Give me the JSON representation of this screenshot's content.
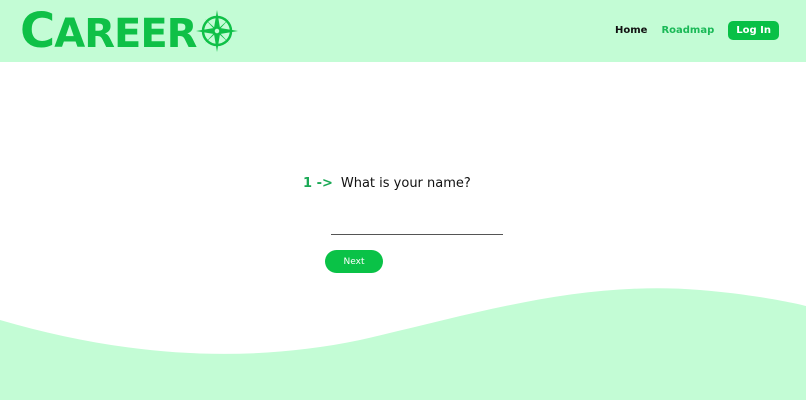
{
  "brand": {
    "logo_text": "AREER",
    "logo_initial": "C",
    "logo_icon": "compass-icon",
    "color": "#0fc047"
  },
  "nav": {
    "home": "Home",
    "roadmap": "Roadmap",
    "login": "Log In"
  },
  "question": {
    "number": "1 ->",
    "text": "What is your name?"
  },
  "form": {
    "name_value": "",
    "next_label": "Next"
  },
  "colors": {
    "header_bg": "#c3fcd5",
    "accent": "#0ac247",
    "wave": "#c3fcd5"
  }
}
